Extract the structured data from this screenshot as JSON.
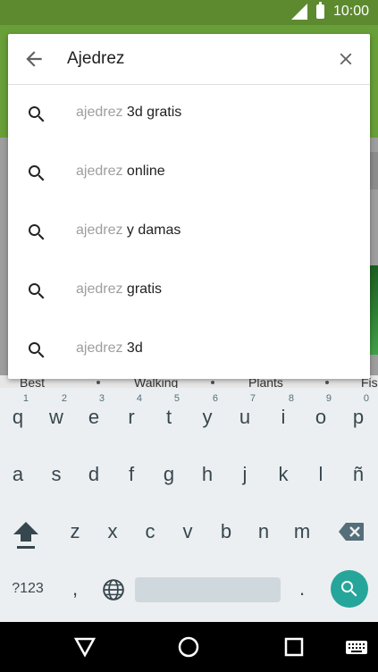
{
  "status_bar": {
    "time": "10:00"
  },
  "search": {
    "query": "Ajedrez",
    "suggestions": [
      {
        "prefix": "ajedrez",
        "suffix": " 3d gratis"
      },
      {
        "prefix": "ajedrez",
        "suffix": " online"
      },
      {
        "prefix": "ajedrez",
        "suffix": " y damas"
      },
      {
        "prefix": "ajedrez",
        "suffix": " gratis"
      },
      {
        "prefix": "ajedrez",
        "suffix": " 3d"
      }
    ]
  },
  "background": {
    "categories": [
      "Best",
      "Walking",
      "Plants",
      "Fis"
    ]
  },
  "keyboard": {
    "row1": [
      {
        "key": "q",
        "hint": "1"
      },
      {
        "key": "w",
        "hint": "2"
      },
      {
        "key": "e",
        "hint": "3"
      },
      {
        "key": "r",
        "hint": "4"
      },
      {
        "key": "t",
        "hint": "5"
      },
      {
        "key": "y",
        "hint": "6"
      },
      {
        "key": "u",
        "hint": "7"
      },
      {
        "key": "i",
        "hint": "8"
      },
      {
        "key": "o",
        "hint": "9"
      },
      {
        "key": "p",
        "hint": "0"
      }
    ],
    "row2": [
      "a",
      "s",
      "d",
      "f",
      "g",
      "h",
      "j",
      "k",
      "l",
      "ñ"
    ],
    "row3": [
      "z",
      "x",
      "c",
      "v",
      "b",
      "n",
      "m"
    ],
    "symbols_label": "?123",
    "comma": ",",
    "period": "."
  },
  "colors": {
    "header_green": "#689f38",
    "status_green": "#5d8a2f",
    "accent_teal": "#26a69a"
  },
  "icons": {
    "back": "arrow-left-icon",
    "clear": "close-icon",
    "suggestion": "search-icon",
    "shift": "shift-arrow-icon",
    "backspace": "backspace-icon",
    "language": "globe-icon",
    "nav_back": "triangle-back-icon",
    "nav_home": "circle-home-icon",
    "nav_recents": "square-recents-icon",
    "nav_keyboard": "keyboard-icon"
  }
}
